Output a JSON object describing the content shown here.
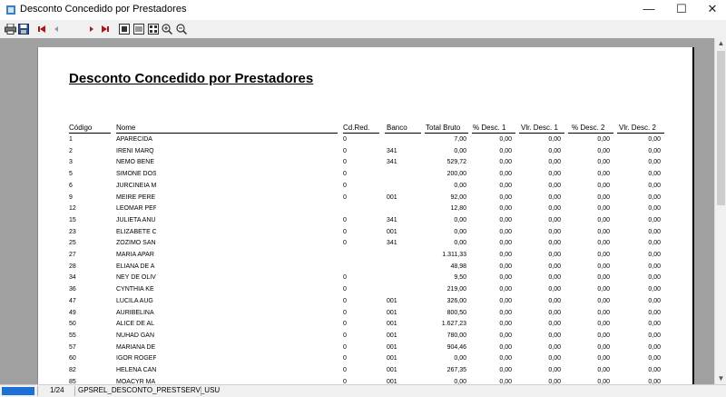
{
  "window": {
    "title": "Desconto Concedido por Prestadores",
    "minimize": "—",
    "maximize": "☐",
    "close": "✕"
  },
  "toolbar": {
    "page_number": "1",
    "buttons": [
      "print-icon",
      "save-icon",
      "first-page-icon",
      "prev-page-icon",
      "next-page-icon",
      "last-page-icon",
      "whole-page-icon",
      "page-width-icon",
      "multi-page-icon",
      "zoom-in-icon",
      "zoom-out-icon"
    ]
  },
  "report": {
    "title": "Desconto Concedido por Prestadores",
    "columns": {
      "codigo": "Código",
      "nome": "Nome",
      "cdred": "Cd.Red.",
      "banco": "Banco",
      "total_bruto": "Total Bruto",
      "pct_desc1": "% Desc. 1",
      "vlr_desc1": "Vlr. Desc. 1",
      "pct_desc2": "% Desc. 2",
      "vlr_desc2": "Vlr. Desc. 2"
    },
    "rows": [
      {
        "codigo": "1",
        "nome": "APARECIDA",
        "cdred": "0",
        "banco": "",
        "total": "7,00",
        "p1": "0,00",
        "v1": "0,00",
        "p2": "0,00",
        "v2": "0,00"
      },
      {
        "codigo": "2",
        "nome": "IRENI MARQ",
        "cdred": "0",
        "banco": "341",
        "total": "0,00",
        "p1": "0,00",
        "v1": "0,00",
        "p2": "0,00",
        "v2": "0,00"
      },
      {
        "codigo": "3",
        "nome": "NEMO BENE",
        "cdred": "0",
        "banco": "341",
        "total": "529,72",
        "p1": "0,00",
        "v1": "0,00",
        "p2": "0,00",
        "v2": "0,00"
      },
      {
        "codigo": "5",
        "nome": "SIMONE DOS",
        "cdred": "0",
        "banco": "",
        "total": "200,00",
        "p1": "0,00",
        "v1": "0,00",
        "p2": "0,00",
        "v2": "0,00"
      },
      {
        "codigo": "6",
        "nome": "JURCINEIA M",
        "cdred": "0",
        "banco": "",
        "total": "0,00",
        "p1": "0,00",
        "v1": "0,00",
        "p2": "0,00",
        "v2": "0,00"
      },
      {
        "codigo": "9",
        "nome": "MEIRE PERE",
        "cdred": "0",
        "banco": "001",
        "total": "92,00",
        "p1": "0,00",
        "v1": "0,00",
        "p2": "0,00",
        "v2": "0,00"
      },
      {
        "codigo": "12",
        "nome": "LEOMAR PEF",
        "cdred": "",
        "banco": "",
        "total": "12,80",
        "p1": "0,00",
        "v1": "0,00",
        "p2": "0,00",
        "v2": "0,00"
      },
      {
        "codigo": "15",
        "nome": "JULIETA ANU",
        "cdred": "0",
        "banco": "341",
        "total": "0,00",
        "p1": "0,00",
        "v1": "0,00",
        "p2": "0,00",
        "v2": "0,00"
      },
      {
        "codigo": "23",
        "nome": "ELIZABETE C",
        "cdred": "0",
        "banco": "001",
        "total": "0,00",
        "p1": "0,00",
        "v1": "0,00",
        "p2": "0,00",
        "v2": "0,00"
      },
      {
        "codigo": "25",
        "nome": "ZOZIMO SAN",
        "cdred": "0",
        "banco": "341",
        "total": "0,00",
        "p1": "0,00",
        "v1": "0,00",
        "p2": "0,00",
        "v2": "0,00"
      },
      {
        "codigo": "27",
        "nome": "MARIA APAR",
        "cdred": "",
        "banco": "",
        "total": "1.311,33",
        "p1": "0,00",
        "v1": "0,00",
        "p2": "0,00",
        "v2": "0,00"
      },
      {
        "codigo": "28",
        "nome": "ELIANA DE A",
        "cdred": "",
        "banco": "",
        "total": "48,98",
        "p1": "0,00",
        "v1": "0,00",
        "p2": "0,00",
        "v2": "0,00"
      },
      {
        "codigo": "34",
        "nome": "NEY DE OLIV",
        "cdred": "0",
        "banco": "",
        "total": "9,50",
        "p1": "0,00",
        "v1": "0,00",
        "p2": "0,00",
        "v2": "0,00"
      },
      {
        "codigo": "36",
        "nome": "CYNTHIA KE",
        "cdred": "0",
        "banco": "",
        "total": "219,00",
        "p1": "0,00",
        "v1": "0,00",
        "p2": "0,00",
        "v2": "0,00"
      },
      {
        "codigo": "47",
        "nome": "LUCILA AUG",
        "cdred": "0",
        "banco": "001",
        "total": "326,00",
        "p1": "0,00",
        "v1": "0,00",
        "p2": "0,00",
        "v2": "0,00"
      },
      {
        "codigo": "49",
        "nome": "AURIBELINA",
        "cdred": "0",
        "banco": "001",
        "total": "800,50",
        "p1": "0,00",
        "v1": "0,00",
        "p2": "0,00",
        "v2": "0,00"
      },
      {
        "codigo": "50",
        "nome": "ALICE DE AL",
        "cdred": "0",
        "banco": "001",
        "total": "1.627,23",
        "p1": "0,00",
        "v1": "0,00",
        "p2": "0,00",
        "v2": "0,00"
      },
      {
        "codigo": "55",
        "nome": "NUHAD GAN",
        "cdred": "0",
        "banco": "001",
        "total": "780,00",
        "p1": "0,00",
        "v1": "0,00",
        "p2": "0,00",
        "v2": "0,00"
      },
      {
        "codigo": "57",
        "nome": "MARIANA DE",
        "cdred": "0",
        "banco": "001",
        "total": "904,46",
        "p1": "0,00",
        "v1": "0,00",
        "p2": "0,00",
        "v2": "0,00"
      },
      {
        "codigo": "60",
        "nome": "IGOR ROGEF",
        "cdred": "0",
        "banco": "001",
        "total": "0,00",
        "p1": "0,00",
        "v1": "0,00",
        "p2": "0,00",
        "v2": "0,00"
      },
      {
        "codigo": "82",
        "nome": "HELENA CAN",
        "cdred": "0",
        "banco": "001",
        "total": "267,35",
        "p1": "0,00",
        "v1": "0,00",
        "p2": "0,00",
        "v2": "0,00"
      },
      {
        "codigo": "85",
        "nome": "MOACYR MA",
        "cdred": "0",
        "banco": "001",
        "total": "0,00",
        "p1": "0,00",
        "v1": "0,00",
        "p2": "0,00",
        "v2": "0,00"
      }
    ]
  },
  "status": {
    "page_count": "1/24",
    "report_name": "GPSREL_DESCONTO_PRESTSERV_USU"
  }
}
